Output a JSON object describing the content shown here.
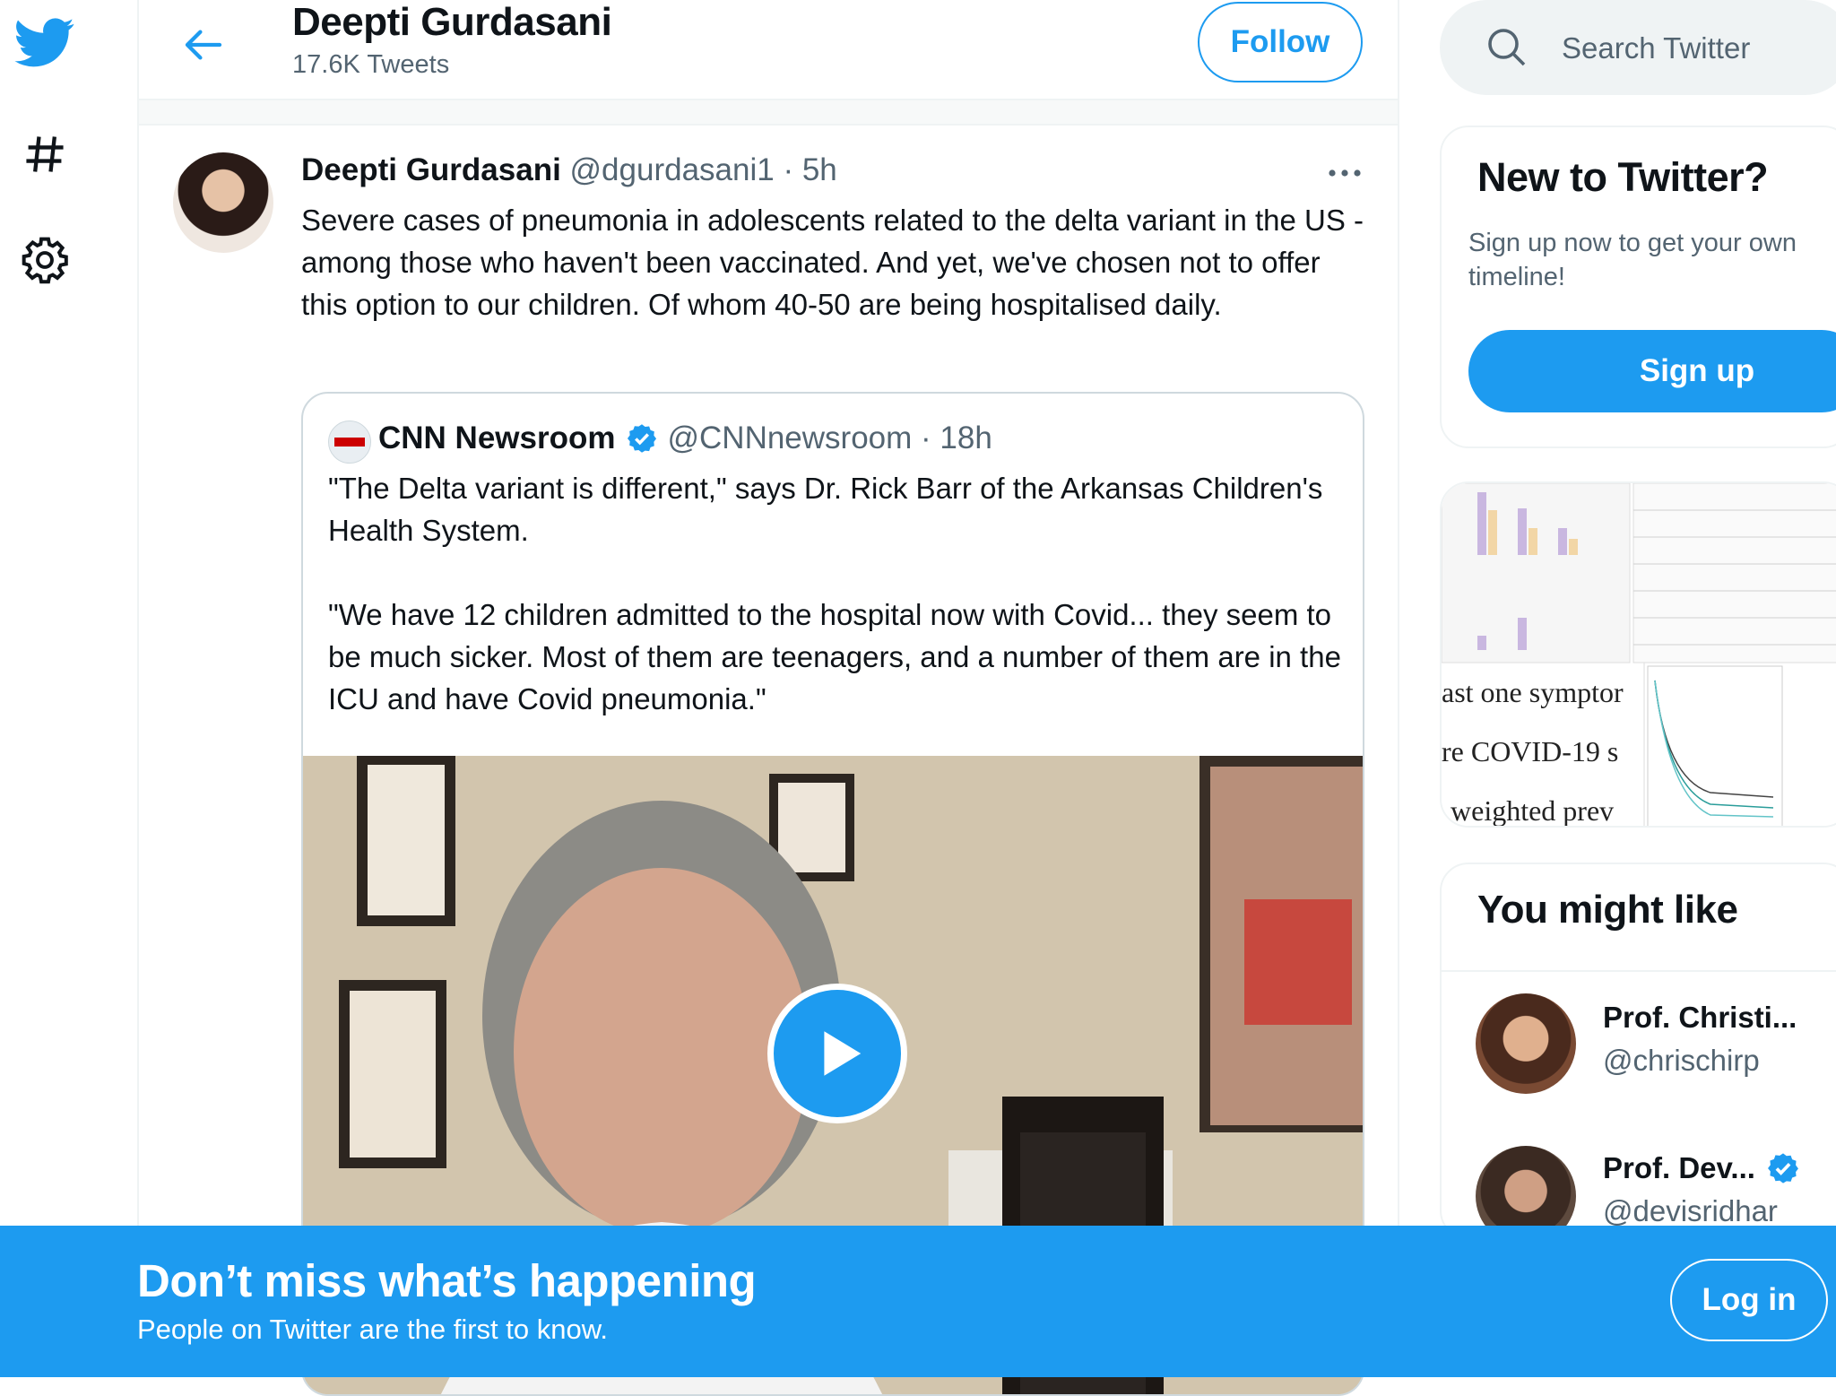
{
  "app": {
    "brand_color": "#1d9bf0"
  },
  "nav": {
    "items": [
      {
        "icon": "twitter-bird-icon"
      },
      {
        "icon": "hashtag-icon"
      },
      {
        "icon": "gear-icon"
      }
    ]
  },
  "header": {
    "name": "Deepti Gurdasani",
    "tweet_count": "17.6K Tweets",
    "follow_label": "Follow"
  },
  "tweet": {
    "author_name": "Deepti Gurdasani",
    "meta": "@dgurdasani1 · 5h",
    "text": "Severe cases of pneumonia in adolescents related to the delta variant in the US - among those who haven't been vaccinated. And yet, we've chosen not to offer this option to our children. Of whom 40-50 are being hospitalised daily.",
    "quote": {
      "author_name": "CNN Newsroom",
      "meta": "@CNNnewsroom · 18h",
      "text": "\"The Delta variant is different,\" says Dr. Rick Barr of the Arkansas Children's Health System.\n\n\"We have 12 children admitted to the hospital now with Covid... they seem to be much sicker. Most of them are teenagers, and a number of them are in the ICU and have Covid pneumonia.\""
    }
  },
  "sidebar": {
    "search_placeholder": "Search Twitter",
    "new_to_twitter": {
      "title": "New to Twitter?",
      "subtitle": "Sign up now to get your own timeline!",
      "signup_label": "Sign up"
    },
    "media_texts": [
      "ast one symptor",
      "re COVID-19 s",
      "weighted prev"
    ],
    "you_might_like": {
      "title": "You might like",
      "suggestions": [
        {
          "name": "Prof. Christi...",
          "handle": "@chrischirp"
        },
        {
          "name": "Prof. Dev...",
          "handle": "@devisridhar"
        }
      ]
    }
  },
  "bottom_bar": {
    "title": "Don’t miss what’s happening",
    "subtitle": "People on Twitter are the first to know.",
    "login_label": "Log in"
  }
}
